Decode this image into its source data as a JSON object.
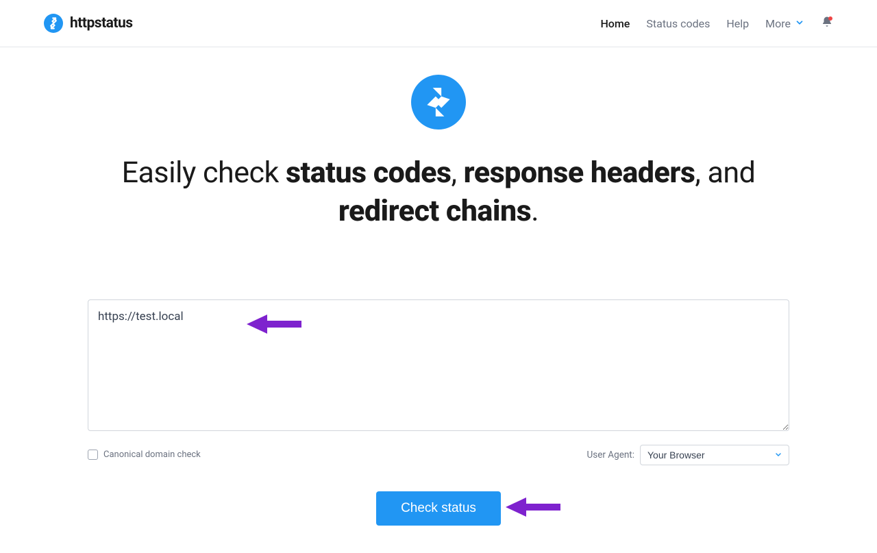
{
  "header": {
    "logo_text": "httpstatus",
    "nav": {
      "home": "Home",
      "status_codes": "Status codes",
      "help": "Help",
      "more": "More"
    }
  },
  "hero": {
    "heading_prefix": "Easily check ",
    "heading_bold1": "status codes",
    "heading_sep1": ", ",
    "heading_bold2": "response headers",
    "heading_sep2": ", and ",
    "heading_bold3": "redirect chains",
    "heading_suffix": "."
  },
  "form": {
    "url_value": "https://test.local",
    "canonical_check_label": "Canonical domain check",
    "user_agent_label": "User Agent:",
    "user_agent_value": "Your Browser",
    "submit_label": "Check status"
  }
}
